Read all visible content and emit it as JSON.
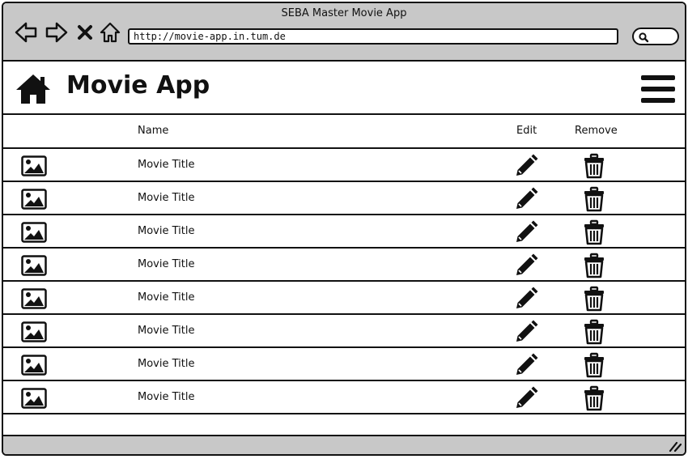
{
  "window": {
    "title": "SEBA Master Movie App"
  },
  "browser": {
    "url": "http://movie-app.in.tum.de",
    "icons": [
      "back-icon",
      "forward-icon",
      "close-icon",
      "home-outline-icon",
      "search-icon"
    ]
  },
  "header": {
    "title": "Movie App",
    "icons": [
      "home-icon",
      "hamburger-menu-icon"
    ]
  },
  "table": {
    "columns": {
      "name": "Name",
      "edit": "Edit",
      "remove": "Remove"
    },
    "rows": [
      {
        "title": "Movie Title"
      },
      {
        "title": "Movie Title"
      },
      {
        "title": "Movie Title"
      },
      {
        "title": "Movie Title"
      },
      {
        "title": "Movie Title"
      },
      {
        "title": "Movie Title"
      },
      {
        "title": "Movie Title"
      },
      {
        "title": "Movie Title"
      }
    ],
    "row_icons": [
      "image-icon",
      "pencil-icon",
      "trash-icon"
    ]
  },
  "colors": {
    "chrome": "#c8c8c8",
    "ink": "#111111",
    "background": "#ffffff"
  }
}
